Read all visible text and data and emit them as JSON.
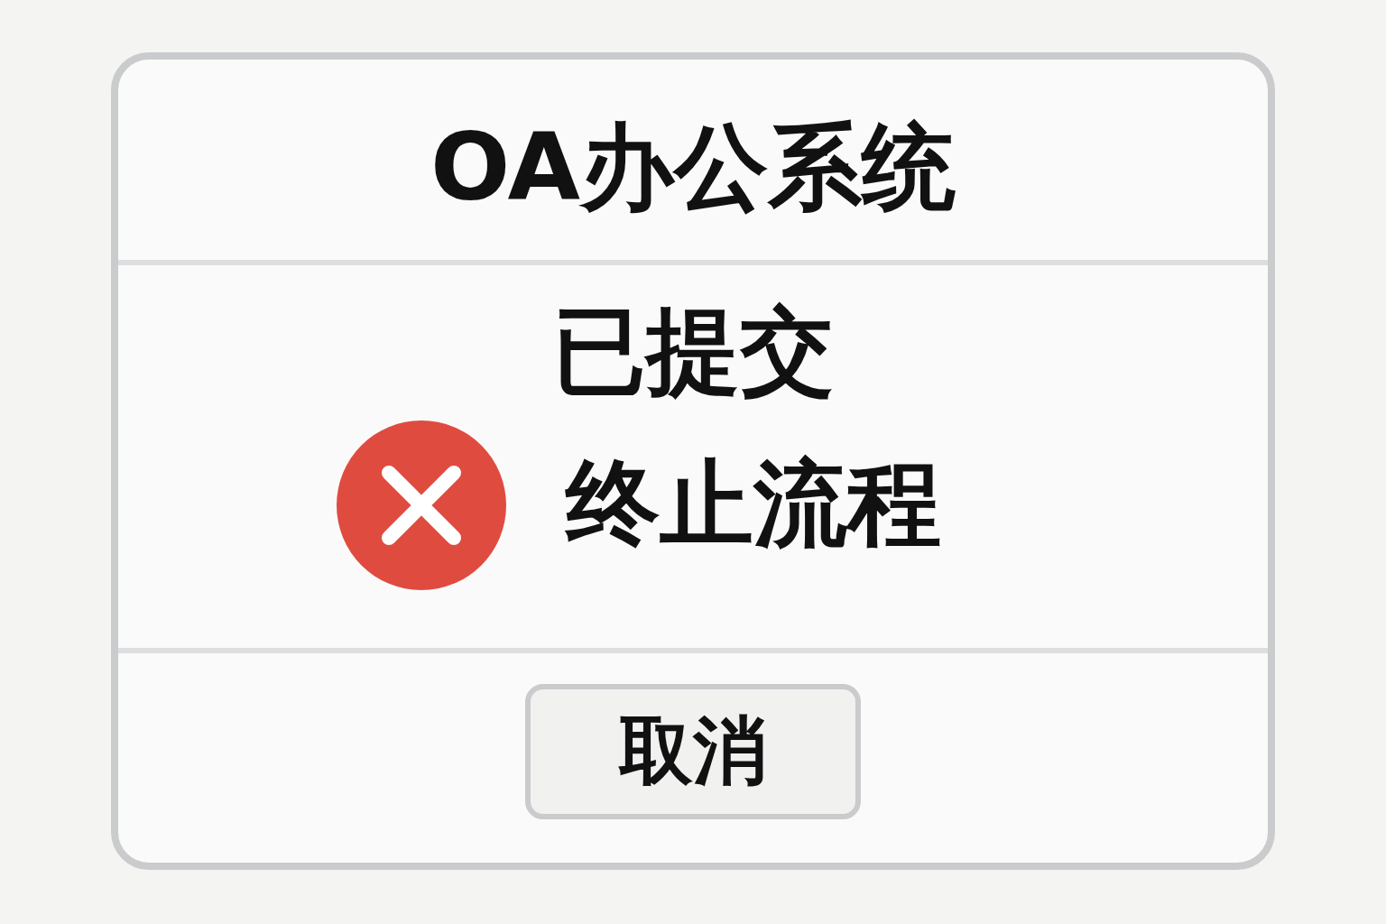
{
  "window": {
    "title": "OA办公系统"
  },
  "status": "已提交",
  "action": {
    "label": "终止流程"
  },
  "buttons": [
    {
      "label": "取消"
    }
  ]
}
